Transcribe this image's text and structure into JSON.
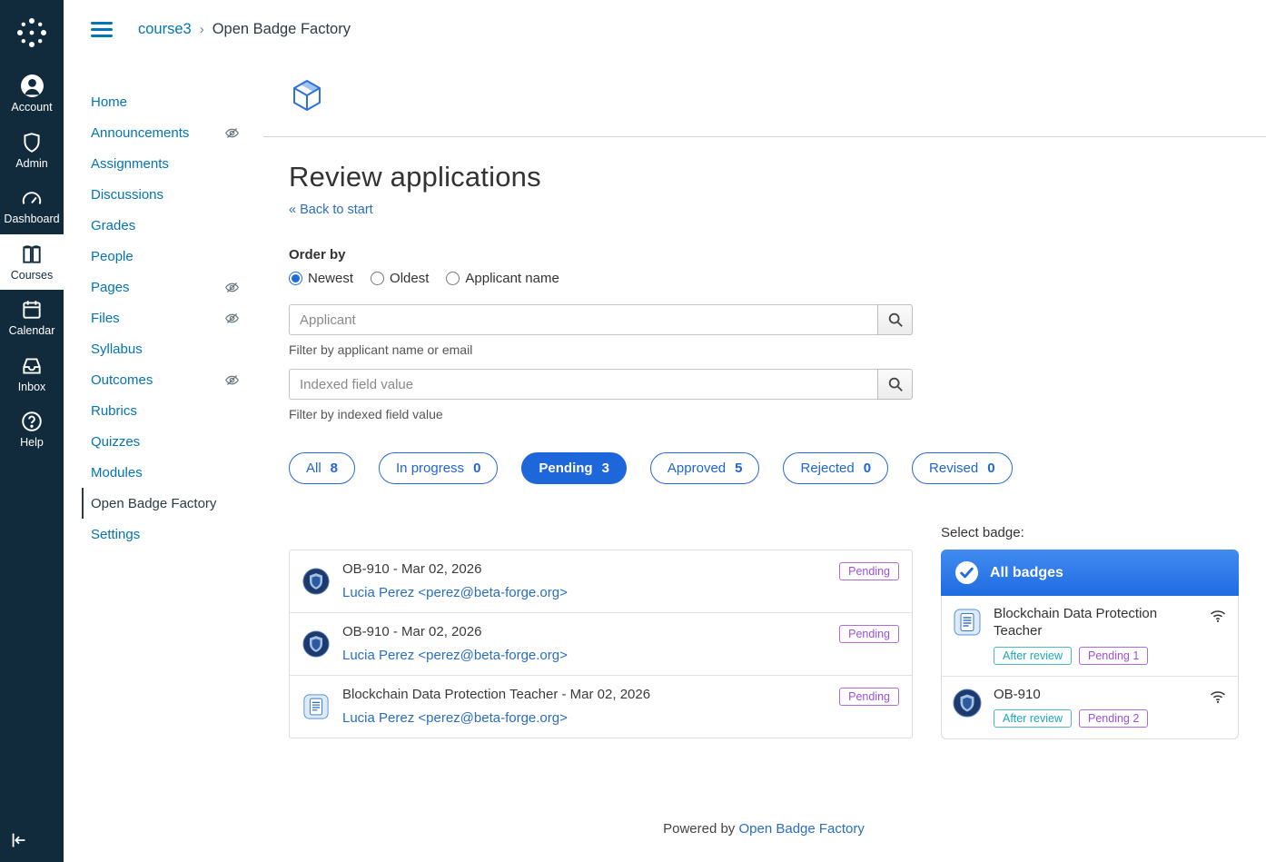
{
  "colors": {
    "global_nav_bg": "#112b3c",
    "canvas_link": "#0374b5",
    "obf_link": "#2a6ebf",
    "pill_blue": "#1d67da",
    "tag_purple": "#9b51e0",
    "tag_teal": "#1fa7b8"
  },
  "global_nav": {
    "items": [
      {
        "label": "Account",
        "icon": "user-icon"
      },
      {
        "label": "Admin",
        "icon": "shield-icon"
      },
      {
        "label": "Dashboard",
        "icon": "gauge-icon"
      },
      {
        "label": "Courses",
        "icon": "book-icon",
        "active": true
      },
      {
        "label": "Calendar",
        "icon": "calendar-icon"
      },
      {
        "label": "Inbox",
        "icon": "inbox-icon"
      },
      {
        "label": "Help",
        "icon": "help-icon"
      }
    ]
  },
  "breadcrumb": {
    "course": "course3",
    "separator": "›",
    "page": "Open Badge Factory"
  },
  "course_nav": {
    "items": [
      {
        "label": "Home",
        "hidden": false
      },
      {
        "label": "Announcements",
        "hidden": true
      },
      {
        "label": "Assignments",
        "hidden": false
      },
      {
        "label": "Discussions",
        "hidden": false
      },
      {
        "label": "Grades",
        "hidden": false
      },
      {
        "label": "People",
        "hidden": false
      },
      {
        "label": "Pages",
        "hidden": true
      },
      {
        "label": "Files",
        "hidden": true
      },
      {
        "label": "Syllabus",
        "hidden": false
      },
      {
        "label": "Outcomes",
        "hidden": true
      },
      {
        "label": "Rubrics",
        "hidden": false
      },
      {
        "label": "Quizzes",
        "hidden": false
      },
      {
        "label": "Modules",
        "hidden": false
      },
      {
        "label": "Open Badge Factory",
        "hidden": false,
        "active": true
      },
      {
        "label": "Settings",
        "hidden": false
      }
    ]
  },
  "main": {
    "title": "Review applications",
    "back_link": "« Back to start",
    "order_by": {
      "label": "Order by",
      "options": [
        {
          "label": "Newest",
          "selected": true
        },
        {
          "label": "Oldest",
          "selected": false
        },
        {
          "label": "Applicant name",
          "selected": false
        }
      ]
    },
    "applicant_filter": {
      "placeholder": "Applicant",
      "help": "Filter by applicant name or email"
    },
    "indexed_filter": {
      "placeholder": "Indexed field value",
      "help": "Filter by indexed field value"
    },
    "status_tabs": [
      {
        "label": "All",
        "count": "8",
        "active": false
      },
      {
        "label": "In progress",
        "count": "0",
        "active": false
      },
      {
        "label": "Pending",
        "count": "3",
        "active": true
      },
      {
        "label": "Approved",
        "count": "5",
        "active": false
      },
      {
        "label": "Rejected",
        "count": "0",
        "active": false
      },
      {
        "label": "Revised",
        "count": "0",
        "active": false
      }
    ],
    "applications": [
      {
        "title": "OB-910 - Mar 02, 2026",
        "applicant": "Lucia Perez <perez@beta-forge.org>",
        "status": "Pending",
        "badge_icon": "shield-badge-icon"
      },
      {
        "title": "OB-910 - Mar 02, 2026",
        "applicant": "Lucia Perez <perez@beta-forge.org>",
        "status": "Pending",
        "badge_icon": "shield-badge-icon"
      },
      {
        "title": "Blockchain Data Protection Teacher - Mar 02, 2026",
        "applicant": "Lucia Perez <perez@beta-forge.org>",
        "status": "Pending",
        "badge_icon": "doc-badge-icon"
      }
    ],
    "select_badge": {
      "label": "Select badge:",
      "all_badges_label": "All badges",
      "badges": [
        {
          "name": "Blockchain Data Protection Teacher",
          "review_tag": "After review",
          "pending_tag": "Pending 1",
          "badge_icon": "doc-badge-icon"
        },
        {
          "name": "OB-910",
          "review_tag": "After review",
          "pending_tag": "Pending 2",
          "badge_icon": "shield-badge-icon"
        }
      ]
    },
    "footer": {
      "text": "Powered by ",
      "link": "Open Badge Factory"
    }
  }
}
